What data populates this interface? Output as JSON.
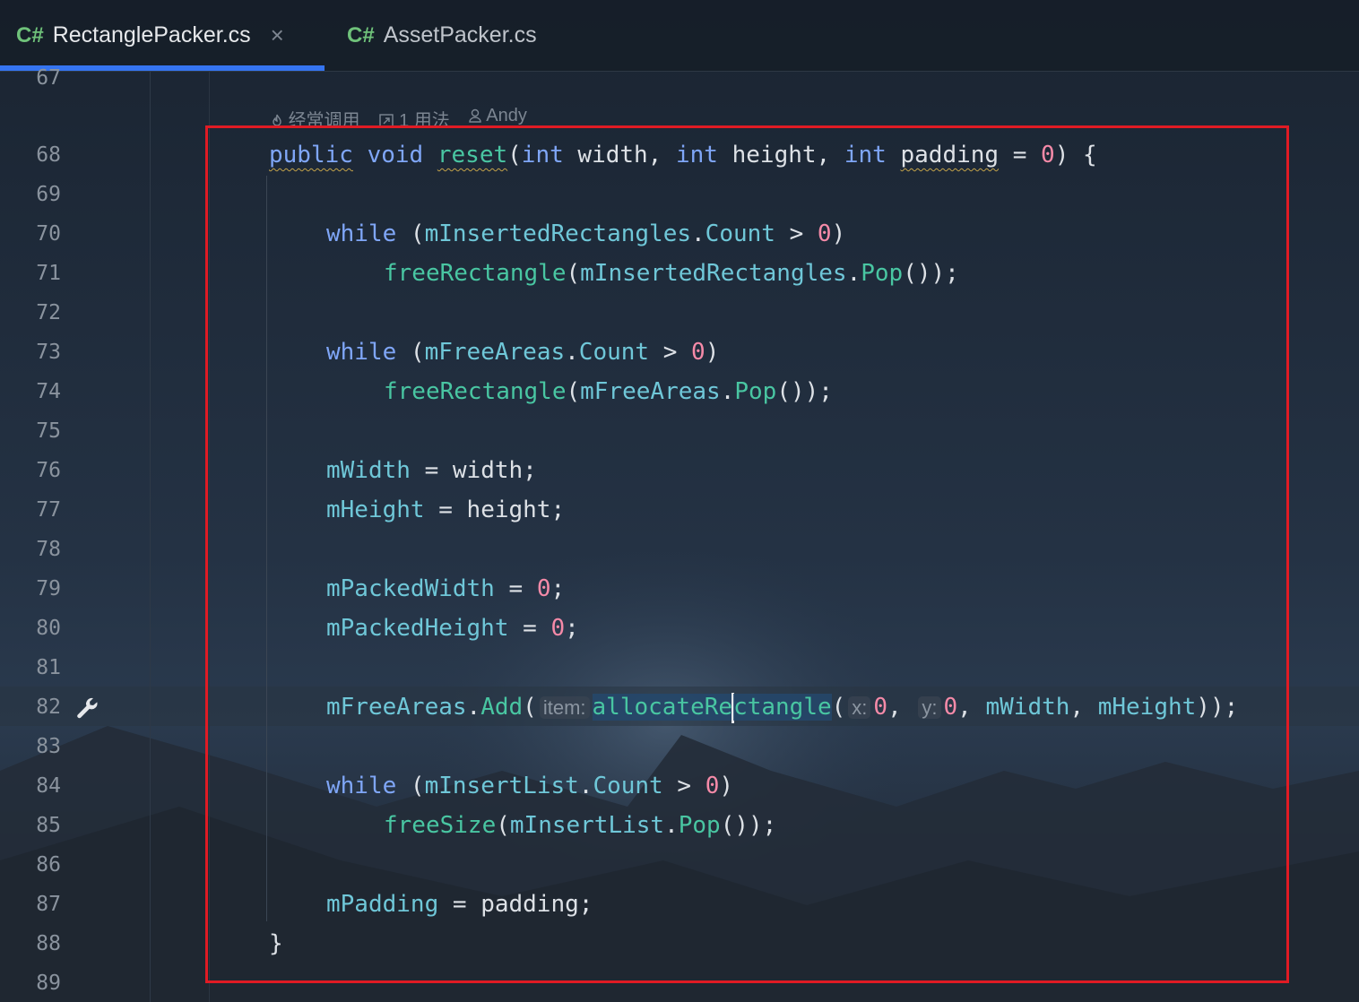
{
  "tabs": [
    {
      "lang": "C#",
      "name": "RectanglePacker.cs",
      "active": true,
      "close": "×"
    },
    {
      "lang": "C#",
      "name": "AssetPacker.cs",
      "active": false
    }
  ],
  "meta": {
    "usage_freq": "经常调用",
    "usages": "1 用法",
    "author": "Andy"
  },
  "line_numbers": [
    "67",
    "68",
    "69",
    "70",
    "71",
    "72",
    "73",
    "74",
    "75",
    "76",
    "77",
    "78",
    "79",
    "80",
    "81",
    "82",
    "83",
    "84",
    "85",
    "86",
    "87",
    "88",
    "89"
  ],
  "code": {
    "l68": {
      "public": "public",
      "void": "void",
      "reset": "reset",
      "p1": "(",
      "int1": "int",
      "width": " width, ",
      "int2": "int",
      "height": " height, ",
      "int3": "int",
      "sp": " ",
      "padding": "padding",
      "eq": " = ",
      "zero": "0",
      "end": ") {"
    },
    "l70": {
      "while": "while",
      "open": " (",
      "field": "mInsertedRectangles",
      "dot": ".",
      "count": "Count",
      "gt": " > ",
      "zero": "0",
      "close": ")"
    },
    "l71": {
      "fn": "freeRectangle",
      "open": "(",
      "field": "mInsertedRectangles",
      "dot": ".",
      "pop": "Pop",
      "close": "());"
    },
    "l73": {
      "while": "while",
      "open": " (",
      "field": "mFreeAreas",
      "dot": ".",
      "count": "Count",
      "gt": " > ",
      "zero": "0",
      "close": ")"
    },
    "l74": {
      "fn": "freeRectangle",
      "open": "(",
      "field": "mFreeAreas",
      "dot": ".",
      "pop": "Pop",
      "close": "());"
    },
    "l76": {
      "field": "mWidth",
      "rest": " = width;"
    },
    "l77": {
      "field": "mHeight",
      "rest": " = height;"
    },
    "l79": {
      "field": "mPackedWidth",
      "eq": " = ",
      "zero": "0",
      "semi": ";"
    },
    "l80": {
      "field": "mPackedHeight",
      "eq": " = ",
      "zero": "0",
      "semi": ";"
    },
    "l82": {
      "field": "mFreeAreas",
      "dot": ".",
      "add": "Add",
      "open": "(",
      "hint_item": "item:",
      "fn_a": "allocateRe",
      "fn_b": "ctangle",
      "open2": "(",
      "hint_x": "x:",
      "x": "0",
      "comma1": ", ",
      "hint_y": "y:",
      "y": "0",
      "comma2": ", ",
      "w": "mWidth",
      "comma3": ", ",
      "h": "mHeight",
      "close": "));"
    },
    "l84": {
      "while": "while",
      "open": " (",
      "field": "mInsertList",
      "dot": ".",
      "count": "Count",
      "gt": " > ",
      "zero": "0",
      "close": ")"
    },
    "l85": {
      "fn": "freeSize",
      "open": "(",
      "field": "mInsertList",
      "dot": ".",
      "pop": "Pop",
      "close": "());"
    },
    "l87": {
      "field": "mPadding",
      "rest": " = padding;"
    },
    "l88": {
      "brace": "}"
    }
  },
  "colors": {
    "accent": "#3574f0",
    "highlight_box": "#e01b24",
    "keyword": "#7fa6f7",
    "function": "#49c6a2",
    "field": "#6fc7d8",
    "number": "#f58aa8"
  },
  "icons": [
    "close-icon",
    "fire-icon",
    "usages-icon",
    "user-icon",
    "wrench-icon"
  ]
}
